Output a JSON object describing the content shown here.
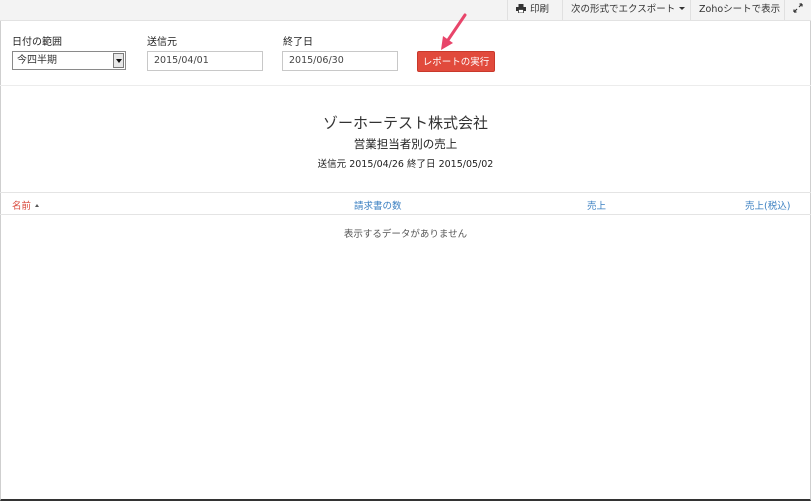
{
  "toolbar": {
    "print_label": "印刷",
    "export_label": "次の形式でエクスポート",
    "zoho_sheet_label": "Zohoシートで表示"
  },
  "filters": {
    "date_range_label": "日付の範囲",
    "date_range_value": "今四半期",
    "from_label": "送信元",
    "from_value": "2015/04/01",
    "to_label": "終了日",
    "to_value": "2015/06/30",
    "run_button_label": "レポートの実行"
  },
  "report": {
    "company": "ゾーホーテスト株式会社",
    "title": "営業担当者別の売上",
    "period_from_label": "送信元",
    "period_from": "2015/04/26",
    "period_to_label": "終了日",
    "period_to": "2015/05/02"
  },
  "table": {
    "columns": [
      "名前",
      "請求書の数",
      "売上",
      "売上(税込)"
    ],
    "empty_message": "表示するデータがありません"
  },
  "colors": {
    "accent": "#e14a3c",
    "link": "#3a7fc1",
    "active_sort": "#d9473a"
  }
}
